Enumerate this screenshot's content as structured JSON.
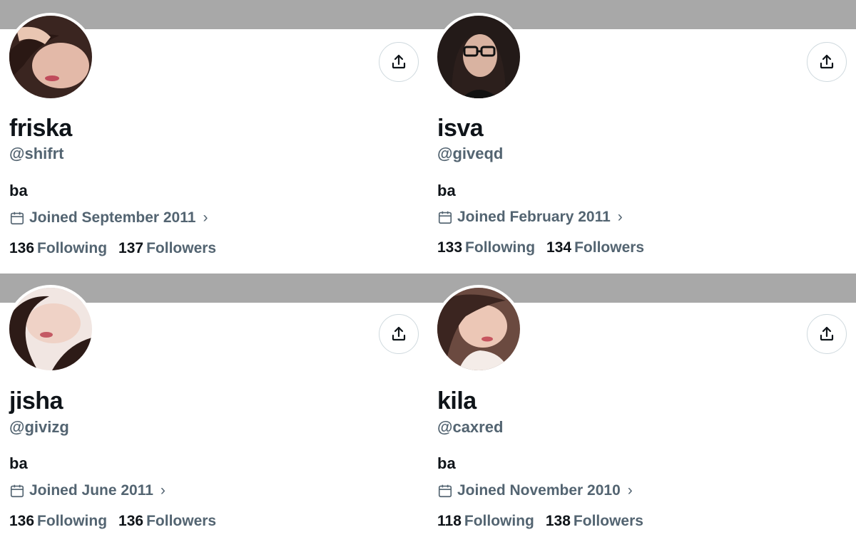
{
  "profiles": [
    {
      "display_name": "friska",
      "handle": "@shifrt",
      "bio": "ba",
      "joined": "Joined September 2011",
      "following_count": "136",
      "following_label": "Following",
      "followers_count": "137",
      "followers_label": "Followers"
    },
    {
      "display_name": "isva",
      "handle": "@giveqd",
      "bio": "ba",
      "joined": "Joined February 2011",
      "following_count": "133",
      "following_label": "Following",
      "followers_count": "134",
      "followers_label": "Followers"
    },
    {
      "display_name": "jisha",
      "handle": "@givizg",
      "bio": "ba",
      "joined": "Joined June 2011",
      "following_count": "136",
      "following_label": "Following",
      "followers_count": "136",
      "followers_label": "Followers"
    },
    {
      "display_name": "kila",
      "handle": "@caxred",
      "bio": "ba",
      "joined": "Joined November 2010",
      "following_count": "118",
      "following_label": "Following",
      "followers_count": "138",
      "followers_label": "Followers"
    }
  ],
  "colors": {
    "banner": "#a8a8a8",
    "primary_text": "#0f1419",
    "secondary_text": "#536471",
    "border": "#cfd9de"
  },
  "icons": {
    "share": "share-upload-icon",
    "calendar": "calendar-icon",
    "chevron": "chevron-right-icon"
  }
}
